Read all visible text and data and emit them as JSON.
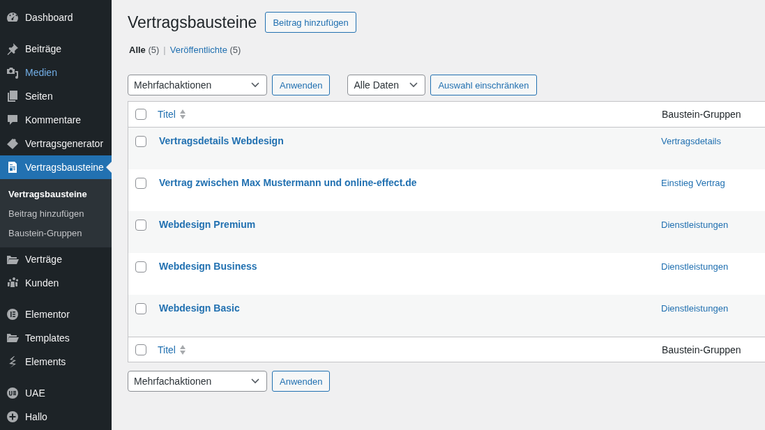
{
  "sidebar": {
    "groups": [
      [
        {
          "label": "Dashboard",
          "selected": false,
          "hovered": false
        }
      ],
      [
        {
          "label": "Beiträge",
          "selected": false,
          "hovered": false
        },
        {
          "label": "Medien",
          "selected": false,
          "hovered": true
        },
        {
          "label": "Seiten",
          "selected": false,
          "hovered": false
        },
        {
          "label": "Kommentare",
          "selected": false,
          "hovered": false
        },
        {
          "label": "Vertragsgenerator",
          "selected": false,
          "hovered": false
        },
        {
          "label": "Vertragsbausteine",
          "selected": true,
          "hovered": false,
          "submenu": [
            {
              "label": "Vertragsbausteine",
              "selected": true
            },
            {
              "label": "Beitrag hinzufügen",
              "selected": false
            },
            {
              "label": "Baustein-Gruppen",
              "selected": false
            }
          ]
        },
        {
          "label": "Verträge",
          "selected": false,
          "hovered": false
        },
        {
          "label": "Kunden",
          "selected": false,
          "hovered": false
        }
      ],
      [
        {
          "label": "Elementor",
          "selected": false,
          "hovered": false
        },
        {
          "label": "Templates",
          "selected": false,
          "hovered": false
        },
        {
          "label": "Elements",
          "selected": false,
          "hovered": false
        }
      ],
      [
        {
          "label": "UAE",
          "selected": false,
          "hovered": false
        },
        {
          "label": "Hallo",
          "selected": false,
          "hovered": false
        }
      ]
    ]
  },
  "page": {
    "title": "Vertragsbausteine",
    "add_button": "Beitrag hinzufügen"
  },
  "views_separator": "|",
  "views": [
    {
      "label": "Alle",
      "count": "(5)",
      "selected": true
    },
    {
      "label": "Veröffentlichte",
      "count": "(5)",
      "selected": false
    }
  ],
  "top_actions": {
    "bulk_select": "Mehrfachaktionen",
    "apply": "Anwenden",
    "date_select": "Alle Daten",
    "filter": "Auswahl einschränken"
  },
  "table": {
    "columns": [
      {
        "label": "Titel",
        "sortable": true
      },
      {
        "label": "Baustein-Gruppen",
        "sortable": false
      }
    ],
    "select_all_checked": false,
    "rows": [
      {
        "title": "Vertragsdetails Webdesign",
        "group": "Vertragsdetails",
        "checked": false
      },
      {
        "title": "Vertrag zwischen Max Mustermann und online-effect.de",
        "group": "Einstieg Vertrag",
        "checked": false
      },
      {
        "title": "Webdesign Premium",
        "group": "Dienstleistungen",
        "checked": false
      },
      {
        "title": "Webdesign Business",
        "group": "Dienstleistungen",
        "checked": false
      },
      {
        "title": "Webdesign Basic",
        "group": "Dienstleistungen",
        "checked": false
      }
    ],
    "footer_columns": [
      {
        "label": "Titel",
        "sortable": true
      },
      {
        "label": "Baustein-Gruppen",
        "sortable": false
      }
    ],
    "footer_select_all_checked": false
  },
  "bottom_actions": {
    "bulk_select": "Mehrfachaktionen",
    "apply": "Anwenden"
  }
}
